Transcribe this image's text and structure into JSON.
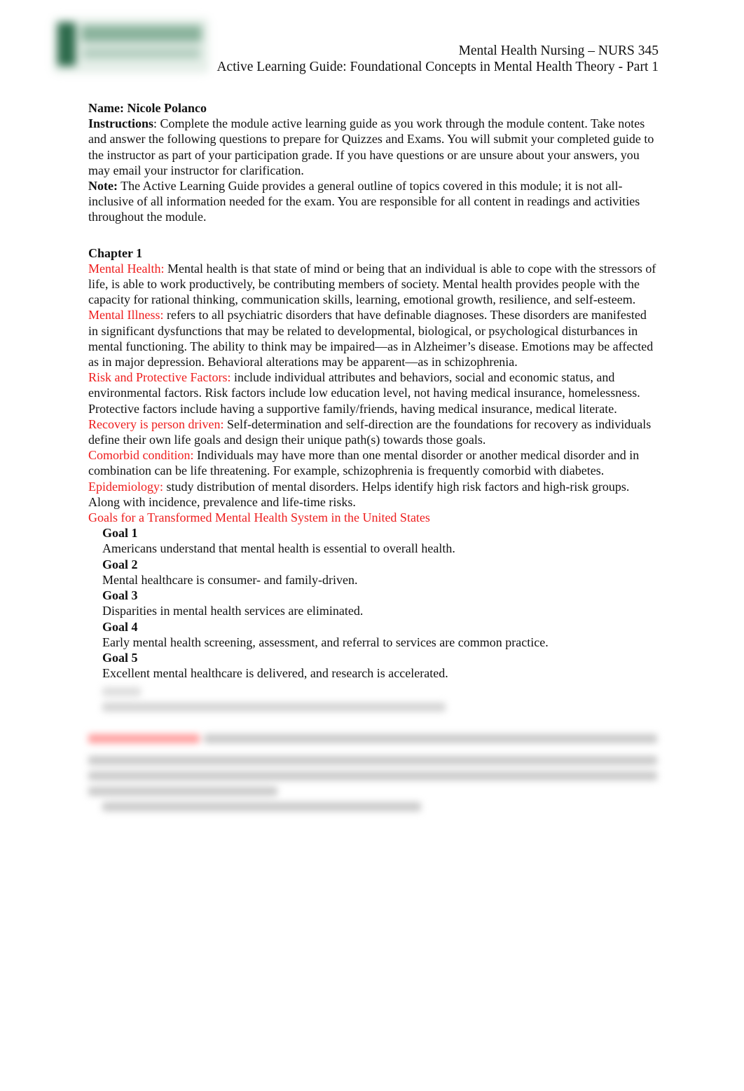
{
  "logo": {
    "name": "felician-university-logo",
    "color": "#2e6b4c"
  },
  "header": {
    "course": "Mental Health Nursing – NURS 345",
    "guide_title": "Active Learning Guide: Foundational Concepts in Mental Health Theory - Part 1"
  },
  "student": {
    "label": "Name:",
    "name": "Nicole Polanco"
  },
  "instructions": {
    "label": "Instructions",
    "text": ": Complete the module active learning guide as you work through the module content. Take notes and answer the following questions to prepare for Quizzes and Exams. You will submit your completed guide to the instructor as part of your participation grade. If you have questions or are unsure about your answers, you may email your instructor for clarification."
  },
  "note": {
    "label": "Note:",
    "text": " The Active Learning Guide provides a general outline of topics covered in this module; it is not all-inclusive of all information needed for the exam. You are responsible for all content in readings and activities throughout the module."
  },
  "chapter": "Chapter 1",
  "accent_color": "#ee1c1c",
  "terms": [
    {
      "term": "Mental Health:",
      "definition": " Mental health is that state of mind or being that an individual is able to cope with the stressors of life, is able to work productively, be contributing members of society. Mental health provides people with the capacity for rational thinking, communication skills, learning, emotional growth, resilience, and self-esteem."
    },
    {
      "term": "Mental Illness:",
      "definition": " refers to all psychiatric disorders that have definable diagnoses. These disorders are manifested in significant dysfunctions that may be related to developmental, biological, or psychological disturbances in mental functioning. The ability to think may be impaired—as in Alzheimer’s disease. Emotions may be affected as in major depression. Behavioral alterations may be apparent—as in schizophrenia."
    },
    {
      "term": "Risk and Protective Factors:",
      "definition": " include individual attributes and behaviors, social and economic status, and environmental factors. Risk factors include low education level, not having medical insurance, homelessness. Protective factors include having a supportive family/friends, having medical insurance, medical literate."
    },
    {
      "term": "Recovery is person driven:",
      "definition": " Self-determination and self-direction are the foundations for recovery as individuals define their own life goals and design their unique path(s) towards those goals."
    },
    {
      "term": "Comorbid condition:",
      "definition": " Individuals may have more than one mental disorder or another medical disorder and in combination can be life threatening. For example, schizophrenia is frequently comorbid with diabetes."
    },
    {
      "term": "Epidemiology:",
      "definition": " study distribution of mental disorders. Helps identify high risk factors and high-risk groups. Along with incidence, prevalence and life-time risks."
    }
  ],
  "goals_heading": "Goals for a Transformed Mental Health System in the United States",
  "goals": [
    {
      "label": "Goal 1",
      "text": "Americans understand that mental health is essential to overall health."
    },
    {
      "label": "Goal 2",
      "text": "Mental healthcare is consumer- and family-driven."
    },
    {
      "label": "Goal 3",
      "text": "Disparities in mental health services are eliminated."
    },
    {
      "label": "Goal 4",
      "text": "Early mental health screening, assessment, and referral to services are common practice."
    },
    {
      "label": "Goal 5",
      "text": "Excellent mental healthcare is delivered, and research is accelerated."
    }
  ]
}
